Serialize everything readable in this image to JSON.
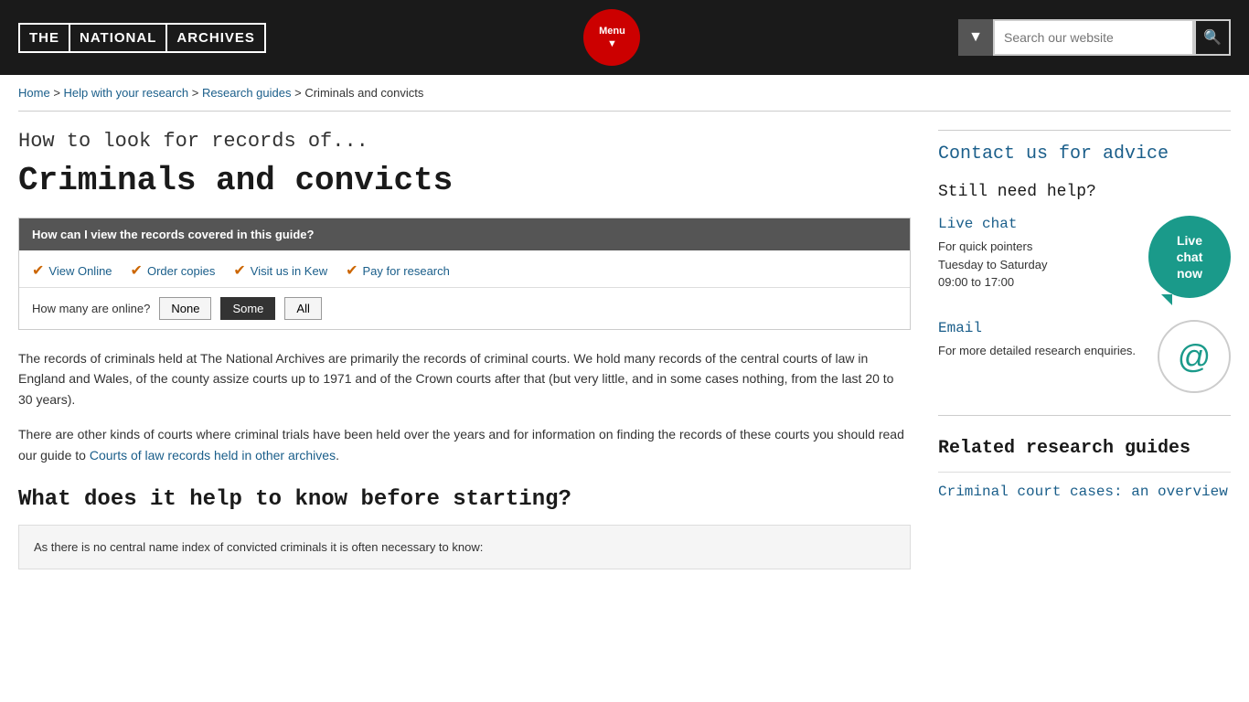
{
  "header": {
    "logo": {
      "part1": "THE",
      "part2": "NATIONAL",
      "part3": "ARCHIVES"
    },
    "menu_label": "Menu",
    "search_placeholder": "Search our website"
  },
  "breadcrumb": {
    "items": [
      {
        "label": "Home",
        "href": "#"
      },
      {
        "label": "Help with your research",
        "href": "#"
      },
      {
        "label": "Research guides",
        "href": "#"
      },
      {
        "label": "Criminals and convicts",
        "href": null
      }
    ]
  },
  "main": {
    "subtitle": "How to look for records of...",
    "title": "Criminals and convicts",
    "records_box": {
      "header": "How can I view the records covered in this guide?",
      "options": [
        {
          "label": "View Online"
        },
        {
          "label": "Order copies"
        },
        {
          "label": "Visit us in Kew"
        },
        {
          "label": "Pay for research"
        }
      ],
      "filter_label": "How many are online?",
      "filter_options": [
        "None",
        "Some",
        "All"
      ],
      "filter_active": "Some"
    },
    "paragraphs": [
      "The records of criminals held at The National Archives are primarily the records of criminal courts. We hold many records of the central courts of law in England and Wales, of the county assize courts up to 1971 and of the Crown courts after that (but very little, and in some cases nothing, from the last 20 to 30 years).",
      "There are other kinds of courts where criminal trials have been held over the years and for information on finding the records of these courts you should read our guide to Courts of law records held in other archives."
    ],
    "courts_link_text": "Courts of law records held in other archives",
    "section2_heading": "What does it help to know before starting?",
    "info_box_text": "As there is no central name index of convicted criminals it is often necessary to know:"
  },
  "sidebar": {
    "contact_link": "Contact us for advice",
    "still_need_help": "Still need help?",
    "live_chat": {
      "link": "Live chat",
      "bubble_lines": [
        "Live",
        "chat",
        "now"
      ],
      "description_line1": "For quick pointers",
      "description_line2": "Tuesday to Saturday",
      "description_line3": "09:00 to 17:00"
    },
    "email": {
      "link": "Email",
      "description": "For more detailed research enquiries."
    },
    "related_guides": {
      "heading": "Related research guides",
      "links": [
        {
          "label": "Criminal court cases: an overview"
        }
      ]
    }
  }
}
